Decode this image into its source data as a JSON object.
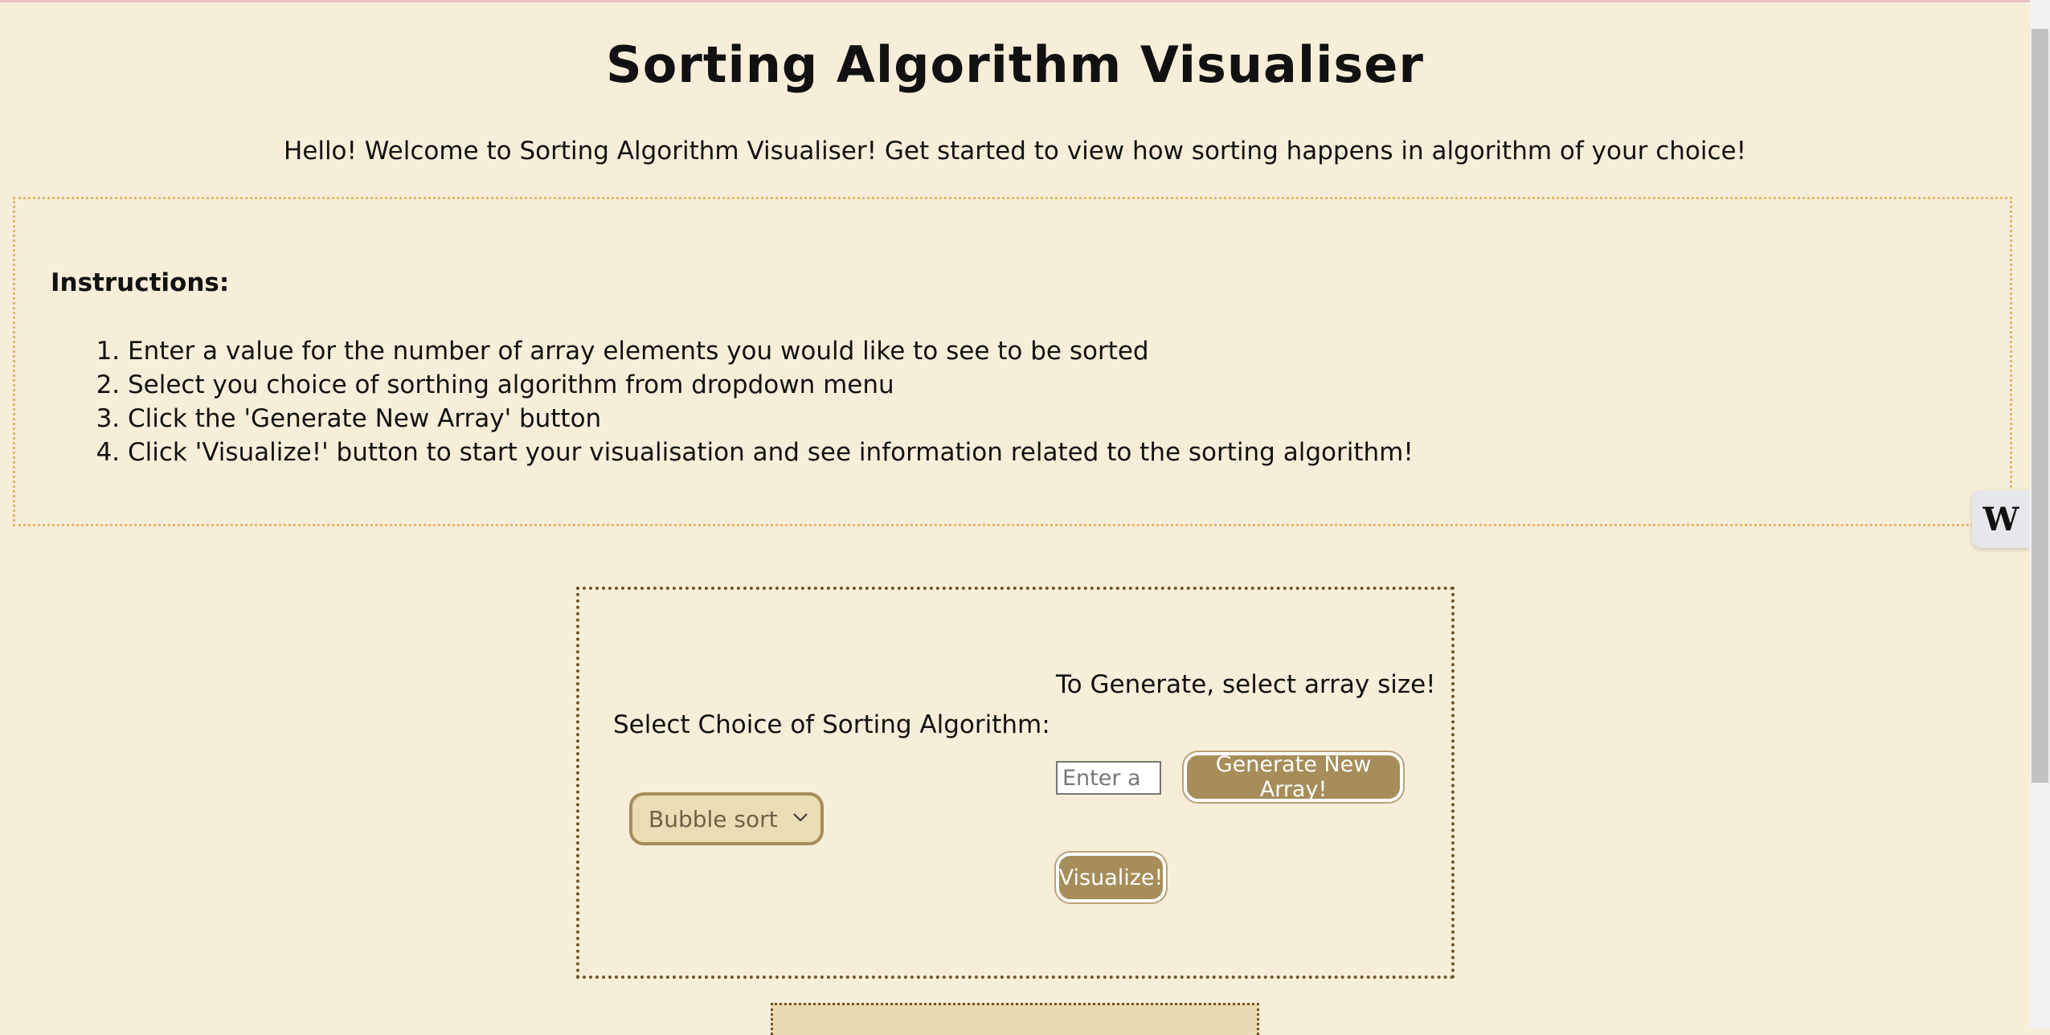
{
  "header": {
    "title": "Sorting Algorithm Visualiser",
    "subtitle": "Hello! Welcome to Sorting Algorithm Visualiser! Get started to view how sorting happens in algorithm of your choice!"
  },
  "instructions": {
    "heading": "Instructions:",
    "steps": [
      "Enter a value for the number of array elements you would like to see to be sorted",
      "Select you choice of sorthing algorithm from dropdown menu",
      "Click the 'Generate New Array' button",
      "Click 'Visualize!' button to start your visualisation and see information related to the sorting algorithm!"
    ]
  },
  "controls": {
    "select_label": "Select Choice of Sorting Algorithm:",
    "selected_algorithm": "Bubble sort",
    "generate_label": "To Generate, select array size!",
    "size_placeholder": "Enter a",
    "generate_button": "Generate New Array!",
    "visualize_button": "Visualize!"
  },
  "widget": {
    "label": "W",
    "icon": "w-logo-icon"
  },
  "colors": {
    "background": "#f7eed9",
    "accent": "#a68d59",
    "instructions_border": "#e3b86a",
    "controls_border": "#6f5428"
  }
}
